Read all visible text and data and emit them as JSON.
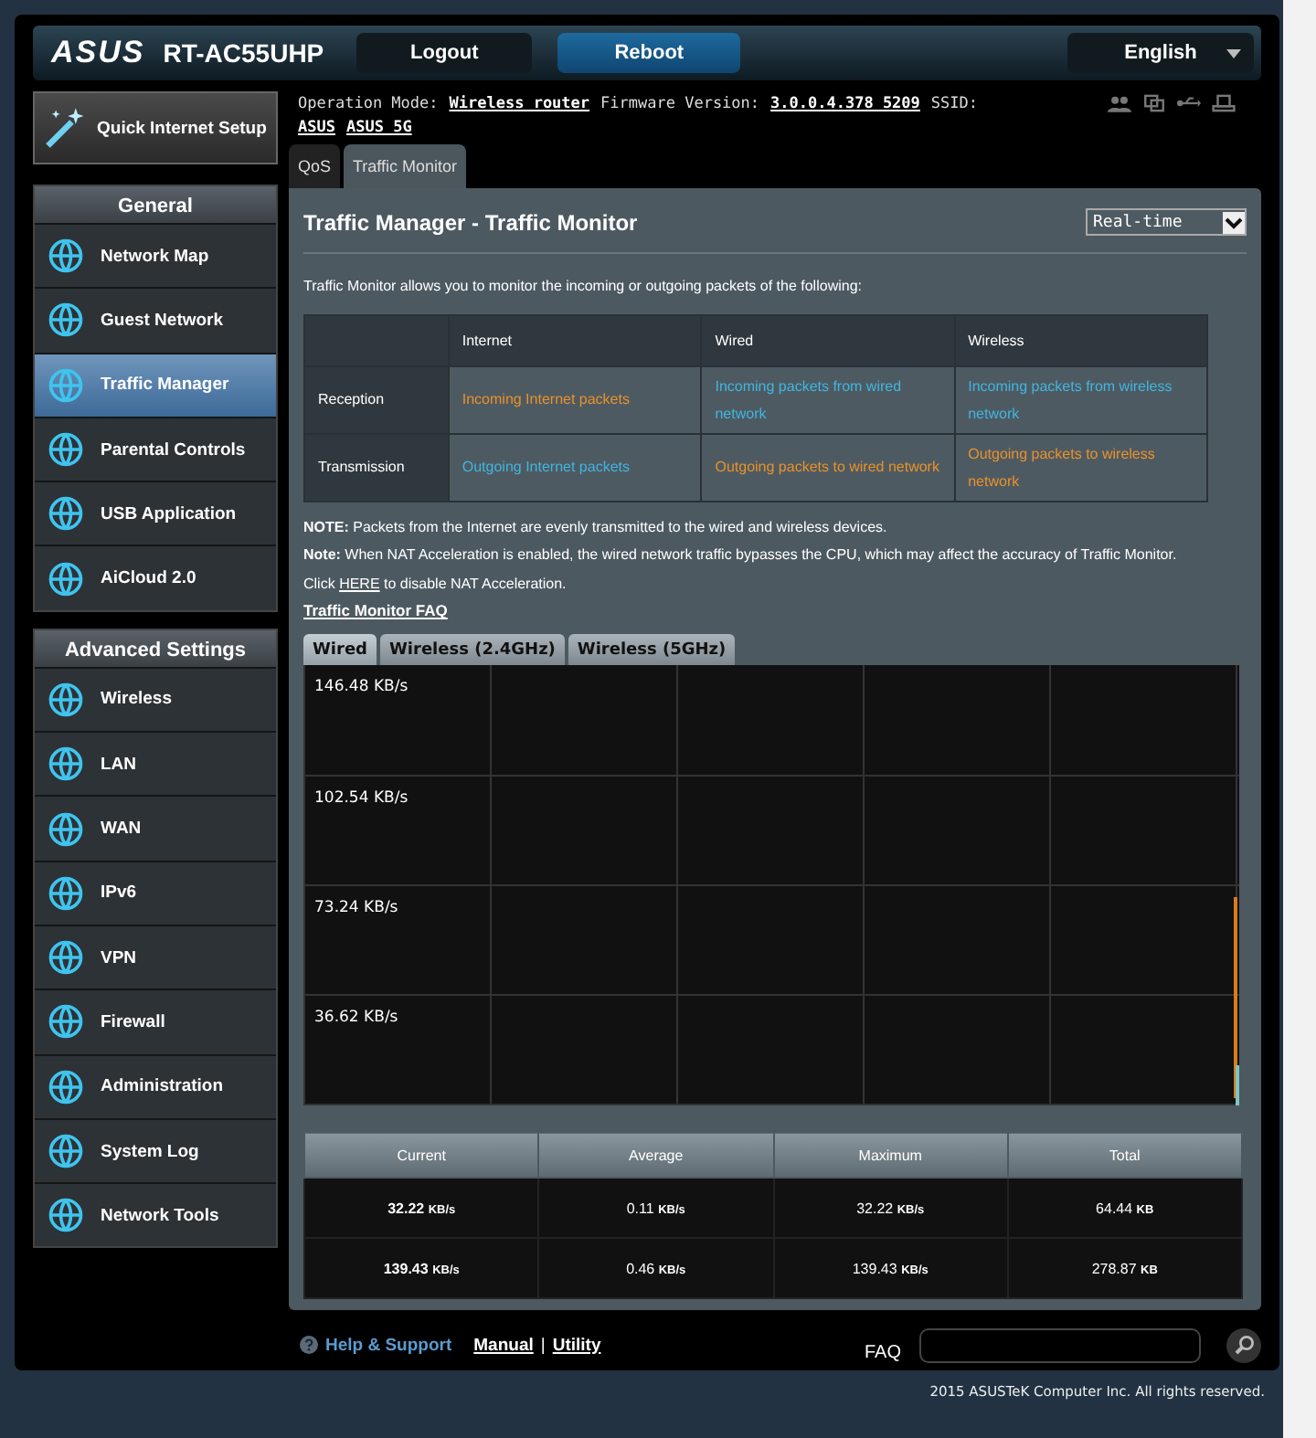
{
  "header": {
    "logo": "ASUS",
    "model": "RT-AC55UHP",
    "buttons": [
      {
        "label": "Logout",
        "selected": false
      },
      {
        "label": "Reboot",
        "selected": true
      }
    ],
    "language": "English"
  },
  "status": {
    "mode_label": "Operation Mode:",
    "mode": "Wireless router",
    "fw_label": "Firmware Version:",
    "fw": "3.0.0.4.378_5209",
    "ssid_label": "SSID:",
    "ssids": [
      "ASUS",
      "ASUS_5G"
    ]
  },
  "page_tabs": [
    {
      "label": "QoS",
      "selected": false
    },
    {
      "label": "Traffic Monitor",
      "selected": true
    }
  ],
  "sidebar": {
    "quick_setup": "Quick Internet Setup",
    "sections": [
      {
        "title": "General",
        "items": [
          {
            "label": "Network Map",
            "selected": false
          },
          {
            "label": "Guest Network",
            "selected": false
          },
          {
            "label": "Traffic Manager",
            "selected": true
          },
          {
            "label": "Parental Controls",
            "selected": false
          },
          {
            "label": "USB Application",
            "selected": false
          },
          {
            "label": "AiCloud 2.0",
            "selected": false
          }
        ]
      },
      {
        "title": "Advanced Settings",
        "items": [
          {
            "label": "Wireless",
            "selected": false
          },
          {
            "label": "LAN",
            "selected": false
          },
          {
            "label": "WAN",
            "selected": false
          },
          {
            "label": "IPv6",
            "selected": false
          },
          {
            "label": "VPN",
            "selected": false
          },
          {
            "label": "Firewall",
            "selected": false
          },
          {
            "label": "Administration",
            "selected": false
          },
          {
            "label": "System Log",
            "selected": false
          },
          {
            "label": "Network Tools",
            "selected": false
          }
        ]
      }
    ]
  },
  "panel": {
    "title": "Traffic Manager - Traffic Monitor",
    "period": "Real-time",
    "intro": "Traffic Monitor allows you to monitor the incoming or outgoing packets of the following:",
    "table": {
      "columns": [
        "Internet",
        "Wired",
        "Wireless"
      ],
      "rows": [
        {
          "label": "Reception",
          "cells": [
            {
              "text": "Incoming Internet packets",
              "color": "#e8922a"
            },
            {
              "text": "Incoming packets from wired network",
              "color": "#3fb6e0"
            },
            {
              "text": "Incoming packets from wireless network",
              "color": "#3fb6e0"
            }
          ]
        },
        {
          "label": "Transmission",
          "cells": [
            {
              "text": "Outgoing Internet packets",
              "color": "#3fb6e0"
            },
            {
              "text": "Outgoing packets to wired network",
              "color": "#e8922a"
            },
            {
              "text": "Outgoing packets to wireless network",
              "color": "#e8922a"
            }
          ]
        }
      ]
    },
    "notes": [
      "**NOTE:** Packets from the Internet are evenly transmitted to the wired and wireless devices.",
      "**Note:** When NAT Acceleration is enabled, the wired network traffic bypasses the CPU, which may affect the accuracy of Traffic Monitor."
    ],
    "click": {
      "before": "Click",
      "link": "HERE",
      "after": "to disable NAT Acceleration."
    },
    "faq_link": "Traffic Monitor FAQ",
    "graph_tabs": [
      {
        "label": "Wired",
        "selected": true
      },
      {
        "label": "Wireless (2.4GHz)",
        "selected": false
      },
      {
        "label": "Wireless (5GHz)",
        "selected": false
      }
    ],
    "graph_labels": [
      "146.48 KB/s",
      "102.54 KB/s",
      "73.24 KB/s",
      "36.62 KB/s"
    ],
    "stats": {
      "columns": [
        "Current",
        "Average",
        "Maximum",
        "Total"
      ],
      "rows": [
        [
          {
            "value": "32.22",
            "unit": "KB/s"
          },
          {
            "value": "0.11",
            "unit": "KB/s"
          },
          {
            "value": "32.22",
            "unit": "KB/s"
          },
          {
            "value": "64.44",
            "unit": "KB"
          }
        ],
        [
          {
            "value": "139.43",
            "unit": "KB/s"
          },
          {
            "value": "0.46",
            "unit": "KB/s"
          },
          {
            "value": "139.43",
            "unit": "KB/s"
          },
          {
            "value": "278.87",
            "unit": "KB"
          }
        ]
      ]
    }
  },
  "footer": {
    "help": "Help & Support",
    "manual": "Manual",
    "sep": "|",
    "utility": "Utility",
    "faq": "FAQ",
    "copyright": "2015 ASUSTeK Computer Inc. All rights reserved."
  }
}
